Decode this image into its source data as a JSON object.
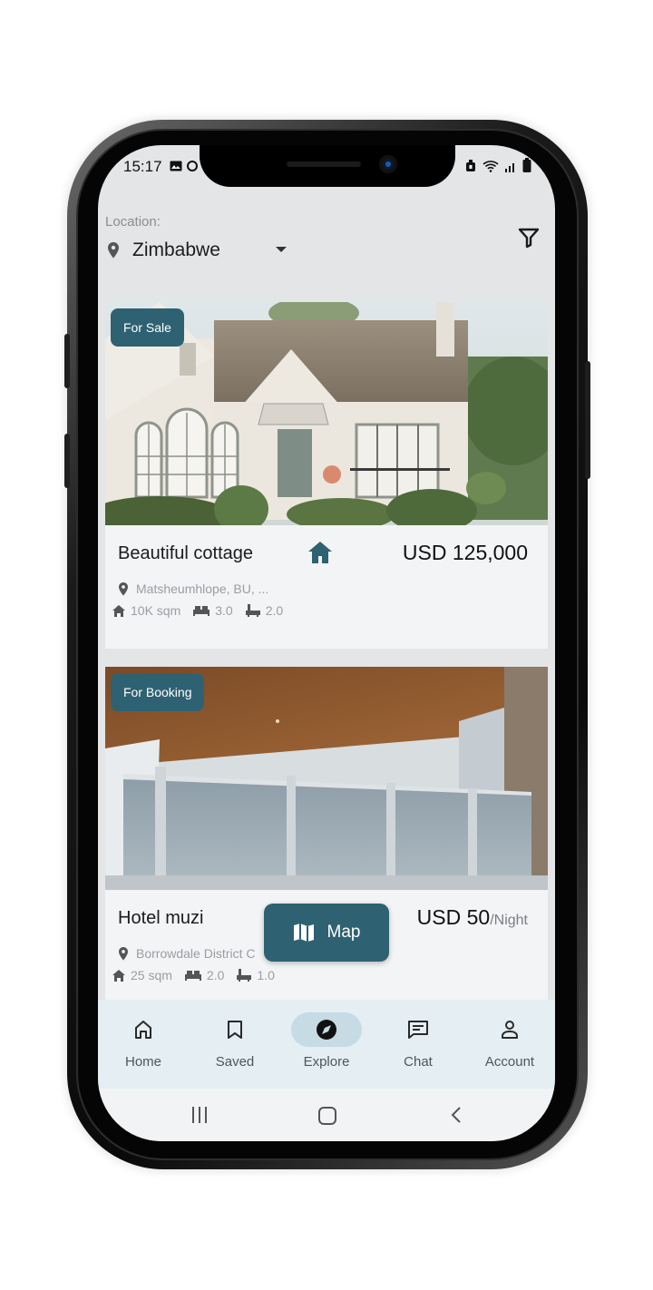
{
  "status_bar": {
    "time": "15:17"
  },
  "location": {
    "label": "Location:",
    "value": "Zimbabwe"
  },
  "listings": [
    {
      "tag": "For Sale",
      "title": "Beautiful cottage",
      "price": "USD 125,000",
      "price_unit": "",
      "address": "Matsheumhlope, BU, ...",
      "area": "10K sqm",
      "bedrooms": "3.0",
      "bathrooms": "2.0"
    },
    {
      "tag": "For Booking",
      "title": "Hotel muzi",
      "price": "USD 50",
      "price_unit": "/Night",
      "address": "Borrowdale District C",
      "area": "25 sqm",
      "bedrooms": "2.0",
      "bathrooms": "1.0"
    }
  ],
  "map_button": {
    "label": "Map"
  },
  "bottom_nav": {
    "items": [
      {
        "label": "Home",
        "icon": "home-icon"
      },
      {
        "label": "Saved",
        "icon": "bookmark-icon"
      },
      {
        "label": "Explore",
        "icon": "compass-icon",
        "active": true
      },
      {
        "label": "Chat",
        "icon": "chat-icon"
      },
      {
        "label": "Account",
        "icon": "person-icon"
      }
    ]
  },
  "colors": {
    "accent": "#2e6272",
    "active_pill": "#c6dbe4",
    "nav_bg": "#e4eef3",
    "screen_bg": "#e4e5e7"
  }
}
